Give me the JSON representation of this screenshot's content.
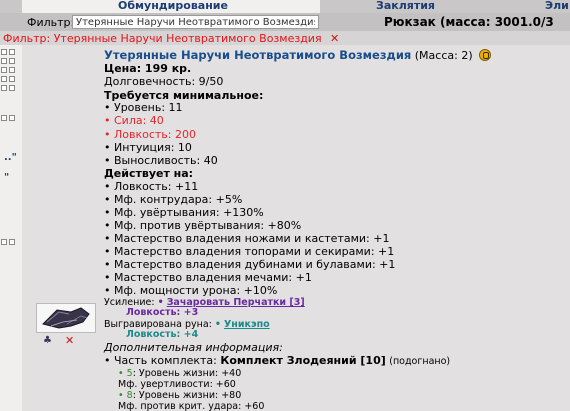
{
  "tabs": [
    {
      "label": "Обмундирование"
    },
    {
      "label": "Заклятия"
    },
    {
      "label": "Эли"
    }
  ],
  "filter": {
    "label": "Фильтр:",
    "value": "Утерянные Наручи Неотвратимого Возмездия"
  },
  "backpack": "Рюкзак (масса: 3001.0/3",
  "active_filter": "Фильтр: Утерянные Наручи Неотвратимого Возмездия",
  "left_strip": {
    "dots": [
      "..\"",
      "\""
    ]
  },
  "item": {
    "name": "Утерянные Наручи Неотвратимого Возмездия",
    "mass": "(Масса: 2)",
    "price": "Цена: 199 кр.",
    "durability": "Долговечность: 9/50",
    "requirements_title": "Требуется минимальное:",
    "requirements": [
      {
        "text": "• Уровень: 11",
        "color": "#000000"
      },
      {
        "text": "• Сила: 40",
        "color": "#e5262c"
      },
      {
        "text": "• Ловкость: 200",
        "color": "#e5262c"
      },
      {
        "text": "• Интуиция: 10",
        "color": "#000000"
      },
      {
        "text": "• Выносливость: 40",
        "color": "#000000"
      }
    ],
    "effects_title": "Действует на:",
    "effects": [
      "• Ловкость: +11",
      "• Мф. контрудара: +5%",
      "• Мф. увёртывания: +130%",
      "• Мф. против увёртывания: +80%",
      "• Мастерство владения ножами и кастетами: +1",
      "• Мастерство владения топорами и секирами: +1",
      "• Мастерство владения дубинами и булавами: +1",
      "• Мастерство владения мечами: +1",
      "• Мф. мощности урона: +10%"
    ],
    "enhancement_label": "Усиление:",
    "enhancement_link": "Зачаровать Перчатки [3]",
    "enhancement_stat": "Ловкость: +3",
    "rune_label": "Выгравирована руна:",
    "rune_link": "Уникэпо",
    "rune_stat": "Ловкость: +4",
    "extra_title": "Дополнительная информация:",
    "set_prefix": "• Часть комплекта:",
    "set_name": "Комплект Злодеяний [10]",
    "set_suffix": "(подогнано)",
    "set_bonuses": [
      {
        "count": "5",
        "line1": "Уровень жизни: +40",
        "line2": "Мф. увертливости: +60"
      },
      {
        "count": "8",
        "line1": "Уровень жизни: +80",
        "line2": "Мф. против крит. удара: +60"
      }
    ]
  },
  "colors": {
    "title": "#1a4d8c",
    "requirement_unmet": "#e5262c",
    "link": "#6a2aa0",
    "rune": "#1c8a8a",
    "set_count": "#2f8d2f"
  },
  "icons": [
    "help-icon",
    "drop-icon",
    "delete-icon",
    "clear-filter-icon"
  ]
}
